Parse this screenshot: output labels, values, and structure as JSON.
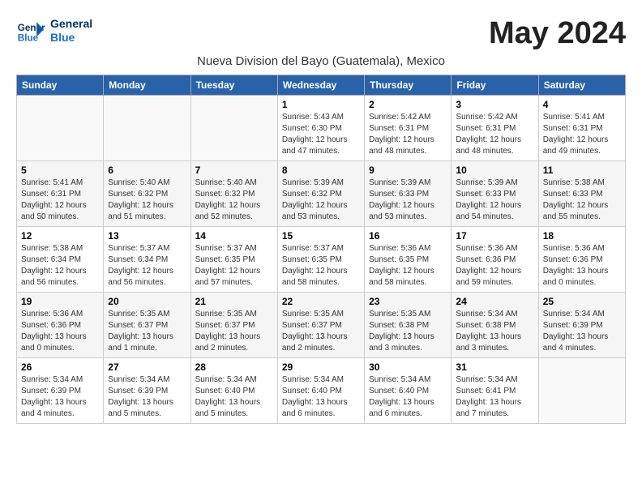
{
  "logo": {
    "text_general": "General",
    "text_blue": "Blue"
  },
  "header": {
    "month_year": "May 2024",
    "subtitle": "Nueva Division del Bayo (Guatemala), Mexico"
  },
  "weekdays": [
    "Sunday",
    "Monday",
    "Tuesday",
    "Wednesday",
    "Thursday",
    "Friday",
    "Saturday"
  ],
  "weeks": [
    {
      "days": [
        {
          "number": "",
          "info": ""
        },
        {
          "number": "",
          "info": ""
        },
        {
          "number": "",
          "info": ""
        },
        {
          "number": "1",
          "info": "Sunrise: 5:43 AM\nSunset: 6:30 PM\nDaylight: 12 hours\nand 47 minutes."
        },
        {
          "number": "2",
          "info": "Sunrise: 5:42 AM\nSunset: 6:31 PM\nDaylight: 12 hours\nand 48 minutes."
        },
        {
          "number": "3",
          "info": "Sunrise: 5:42 AM\nSunset: 6:31 PM\nDaylight: 12 hours\nand 48 minutes."
        },
        {
          "number": "4",
          "info": "Sunrise: 5:41 AM\nSunset: 6:31 PM\nDaylight: 12 hours\nand 49 minutes."
        }
      ]
    },
    {
      "days": [
        {
          "number": "5",
          "info": "Sunrise: 5:41 AM\nSunset: 6:31 PM\nDaylight: 12 hours\nand 50 minutes."
        },
        {
          "number": "6",
          "info": "Sunrise: 5:40 AM\nSunset: 6:32 PM\nDaylight: 12 hours\nand 51 minutes."
        },
        {
          "number": "7",
          "info": "Sunrise: 5:40 AM\nSunset: 6:32 PM\nDaylight: 12 hours\nand 52 minutes."
        },
        {
          "number": "8",
          "info": "Sunrise: 5:39 AM\nSunset: 6:32 PM\nDaylight: 12 hours\nand 53 minutes."
        },
        {
          "number": "9",
          "info": "Sunrise: 5:39 AM\nSunset: 6:33 PM\nDaylight: 12 hours\nand 53 minutes."
        },
        {
          "number": "10",
          "info": "Sunrise: 5:39 AM\nSunset: 6:33 PM\nDaylight: 12 hours\nand 54 minutes."
        },
        {
          "number": "11",
          "info": "Sunrise: 5:38 AM\nSunset: 6:33 PM\nDaylight: 12 hours\nand 55 minutes."
        }
      ]
    },
    {
      "days": [
        {
          "number": "12",
          "info": "Sunrise: 5:38 AM\nSunset: 6:34 PM\nDaylight: 12 hours\nand 56 minutes."
        },
        {
          "number": "13",
          "info": "Sunrise: 5:37 AM\nSunset: 6:34 PM\nDaylight: 12 hours\nand 56 minutes."
        },
        {
          "number": "14",
          "info": "Sunrise: 5:37 AM\nSunset: 6:35 PM\nDaylight: 12 hours\nand 57 minutes."
        },
        {
          "number": "15",
          "info": "Sunrise: 5:37 AM\nSunset: 6:35 PM\nDaylight: 12 hours\nand 58 minutes."
        },
        {
          "number": "16",
          "info": "Sunrise: 5:36 AM\nSunset: 6:35 PM\nDaylight: 12 hours\nand 58 minutes."
        },
        {
          "number": "17",
          "info": "Sunrise: 5:36 AM\nSunset: 6:36 PM\nDaylight: 12 hours\nand 59 minutes."
        },
        {
          "number": "18",
          "info": "Sunrise: 5:36 AM\nSunset: 6:36 PM\nDaylight: 13 hours\nand 0 minutes."
        }
      ]
    },
    {
      "days": [
        {
          "number": "19",
          "info": "Sunrise: 5:36 AM\nSunset: 6:36 PM\nDaylight: 13 hours\nand 0 minutes."
        },
        {
          "number": "20",
          "info": "Sunrise: 5:35 AM\nSunset: 6:37 PM\nDaylight: 13 hours\nand 1 minute."
        },
        {
          "number": "21",
          "info": "Sunrise: 5:35 AM\nSunset: 6:37 PM\nDaylight: 13 hours\nand 2 minutes."
        },
        {
          "number": "22",
          "info": "Sunrise: 5:35 AM\nSunset: 6:37 PM\nDaylight: 13 hours\nand 2 minutes."
        },
        {
          "number": "23",
          "info": "Sunrise: 5:35 AM\nSunset: 6:38 PM\nDaylight: 13 hours\nand 3 minutes."
        },
        {
          "number": "24",
          "info": "Sunrise: 5:34 AM\nSunset: 6:38 PM\nDaylight: 13 hours\nand 3 minutes."
        },
        {
          "number": "25",
          "info": "Sunrise: 5:34 AM\nSunset: 6:39 PM\nDaylight: 13 hours\nand 4 minutes."
        }
      ]
    },
    {
      "days": [
        {
          "number": "26",
          "info": "Sunrise: 5:34 AM\nSunset: 6:39 PM\nDaylight: 13 hours\nand 4 minutes."
        },
        {
          "number": "27",
          "info": "Sunrise: 5:34 AM\nSunset: 6:39 PM\nDaylight: 13 hours\nand 5 minutes."
        },
        {
          "number": "28",
          "info": "Sunrise: 5:34 AM\nSunset: 6:40 PM\nDaylight: 13 hours\nand 5 minutes."
        },
        {
          "number": "29",
          "info": "Sunrise: 5:34 AM\nSunset: 6:40 PM\nDaylight: 13 hours\nand 6 minutes."
        },
        {
          "number": "30",
          "info": "Sunrise: 5:34 AM\nSunset: 6:40 PM\nDaylight: 13 hours\nand 6 minutes."
        },
        {
          "number": "31",
          "info": "Sunrise: 5:34 AM\nSunset: 6:41 PM\nDaylight: 13 hours\nand 7 minutes."
        },
        {
          "number": "",
          "info": ""
        }
      ]
    }
  ]
}
